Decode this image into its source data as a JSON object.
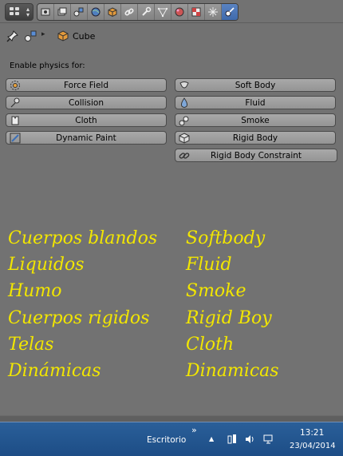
{
  "header": {
    "object_name": "Cube",
    "icons": [
      "editor-type-icon",
      "render-icon",
      "render-layers-icon",
      "scene-icon",
      "world-icon",
      "object-icon",
      "constraints-icon",
      "modifiers-icon",
      "data-icon",
      "material-icon",
      "texture-icon",
      "particles-icon",
      "physics-icon"
    ]
  },
  "physics": {
    "label": "Enable physics for:",
    "left_buttons": [
      {
        "label": "Force Field",
        "icon": "force-field-icon"
      },
      {
        "label": "Collision",
        "icon": "collision-icon"
      },
      {
        "label": "Cloth",
        "icon": "cloth-icon"
      },
      {
        "label": "Dynamic Paint",
        "icon": "dynamic-paint-icon"
      }
    ],
    "right_buttons": [
      {
        "label": "Soft Body",
        "icon": "soft-body-icon"
      },
      {
        "label": "Fluid",
        "icon": "fluid-icon"
      },
      {
        "label": "Smoke",
        "icon": "smoke-icon"
      },
      {
        "label": "Rigid Body",
        "icon": "rigid-body-icon"
      },
      {
        "label": "Rigid Body Constraint",
        "icon": "rigid-body-constraint-icon"
      }
    ]
  },
  "notes": {
    "spanish": [
      "Cuerpos blandos",
      "Liquidos",
      "Humo",
      "Cuerpos rigidos",
      "Telas",
      "Dinámicas"
    ],
    "english": [
      "Softbody",
      "Fluid",
      "Smoke",
      "Rigid Boy",
      "Cloth",
      "Dinamicas"
    ],
    "color": "#f2e600"
  },
  "taskbar": {
    "desktop_label": "Escritorio",
    "more_label": "»",
    "up_label": "▲",
    "time": "13:21",
    "date": "23/04/2014"
  },
  "colors": {
    "panel_bg": "#727272",
    "active_tab": "#4a74b6",
    "taskbar": "#245892"
  }
}
